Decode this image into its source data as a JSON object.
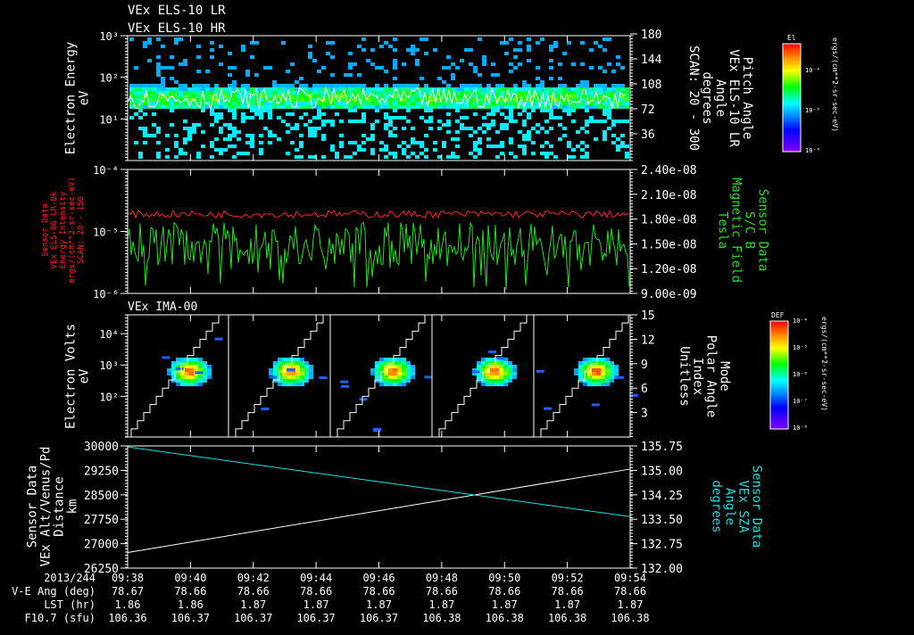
{
  "colors": {
    "background": "#000000",
    "axes": "#ffffff",
    "flux": "#ff2020",
    "bfield": "#20e020",
    "sza": "#20e0e0",
    "altitude": "#ffffff"
  },
  "chart_data": [
    {
      "type": "heatmap",
      "titles": [
        "VEx ELS-10 LR",
        "VEx ELS-10 HR"
      ],
      "ylabel": [
        "Electron Energy",
        "eV"
      ],
      "yscale": "log",
      "ylim": [
        1,
        1000
      ],
      "yticks": [
        "10¹",
        "10²",
        "10³"
      ],
      "y2label": [
        "Pitch Angle",
        "VEx ELS-10 LR",
        "Angle",
        "degrees",
        "SCAN: 20 - 300"
      ],
      "y2lim": [
        0,
        180
      ],
      "y2ticks": [
        "36",
        "72",
        "108",
        "144",
        "180"
      ],
      "band_ev": [
        20,
        60
      ],
      "colorbar": {
        "title": "El",
        "ticks": [
          "10⁻⁶",
          "10⁻⁵",
          "10⁻⁴"
        ],
        "unit": "ergs/(cm**2-sr-sec-eV)"
      }
    },
    {
      "type": "line",
      "ylabel": [
        "Sensor Data",
        "VEx ELS-06 LR-Bk",
        "Energy Intensity",
        "ergs/(cm**2-sr-sec-eV)",
        "SCAN: 20 - 150"
      ],
      "yscale": "log",
      "ylim": [
        1e-06,
        0.0001
      ],
      "yticks": [
        "10⁻⁶",
        "10⁻⁵",
        "10⁻⁴"
      ],
      "y2label": [
        "Sensor Data",
        "S/C B",
        "Magnetic Field",
        "Tesla"
      ],
      "y2lim": [
        9e-09,
        2.4e-08
      ],
      "y2ticks": [
        "9.00e-09",
        "1.20e-08",
        "1.50e-08",
        "1.80e-08",
        "2.10e-08",
        "2.40e-08"
      ],
      "series": [
        {
          "axis": "left",
          "color": "#ff2020",
          "level": 1.9e-05
        },
        {
          "axis": "right",
          "color": "#20e020",
          "level": 1.5e-08
        }
      ]
    },
    {
      "type": "heatmap",
      "title": "VEx IMA-00",
      "ylabel": [
        "Electron Volts",
        "eV"
      ],
      "yscale": "log",
      "ylim": [
        5,
        40000
      ],
      "yticks": [
        "10²",
        "10³",
        "10⁴"
      ],
      "y2label": [
        "Mode",
        "Polar Angle",
        "Index",
        "Unitless"
      ],
      "y2lim": [
        0,
        15
      ],
      "y2ticks": [
        "3",
        "6",
        "9",
        "12",
        "15"
      ],
      "peak_ev": 700,
      "colorbar": {
        "title": "DEF",
        "ticks": [
          "10⁻⁸",
          "10⁻⁷",
          "10⁻⁶",
          "10⁻⁵",
          "10⁻⁴"
        ],
        "unit": "ergs/(cm**2-sr-sec-eV)"
      }
    },
    {
      "type": "line",
      "ylabel": [
        "Sensor Data",
        "VEx Alt/Venus/Pd",
        "Distance",
        "km"
      ],
      "ylim": [
        26250,
        30000
      ],
      "yticks": [
        "26250",
        "27000",
        "27750",
        "28500",
        "29250",
        "30000"
      ],
      "y2label": [
        "Sensor Data",
        "VEx SZA",
        "Angle",
        "degrees"
      ],
      "y2lim": [
        132.0,
        135.75
      ],
      "y2ticks": [
        "132.00",
        "132.75",
        "133.50",
        "134.25",
        "135.00",
        "135.75"
      ],
      "series": [
        {
          "axis": "left",
          "color": "#ffffff",
          "x": [
            "09:38",
            "09:54"
          ],
          "y": [
            26730,
            29290
          ]
        },
        {
          "axis": "right",
          "color": "#20e0e0",
          "x": [
            "09:38",
            "09:54"
          ],
          "y": [
            135.72,
            133.58
          ]
        }
      ]
    }
  ],
  "time_axis": {
    "date": "2013/244",
    "ticks": [
      "09:38",
      "09:40",
      "09:42",
      "09:44",
      "09:46",
      "09:48",
      "09:50",
      "09:52",
      "09:54"
    ],
    "rows": [
      {
        "label": "V-E Ang (deg)",
        "values": [
          "78.67",
          "78.66",
          "78.66",
          "78.66",
          "78.66",
          "78.66",
          "78.66",
          "78.66",
          "78.66"
        ]
      },
      {
        "label": "LST (hr)",
        "values": [
          "1.86",
          "1.86",
          "1.87",
          "1.87",
          "1.87",
          "1.87",
          "1.87",
          "1.87",
          "1.87"
        ]
      },
      {
        "label": "F10.7 (sfu)",
        "values": [
          "106.36",
          "106.37",
          "106.37",
          "106.37",
          "106.37",
          "106.38",
          "106.38",
          "106.38",
          "106.38"
        ]
      }
    ]
  }
}
